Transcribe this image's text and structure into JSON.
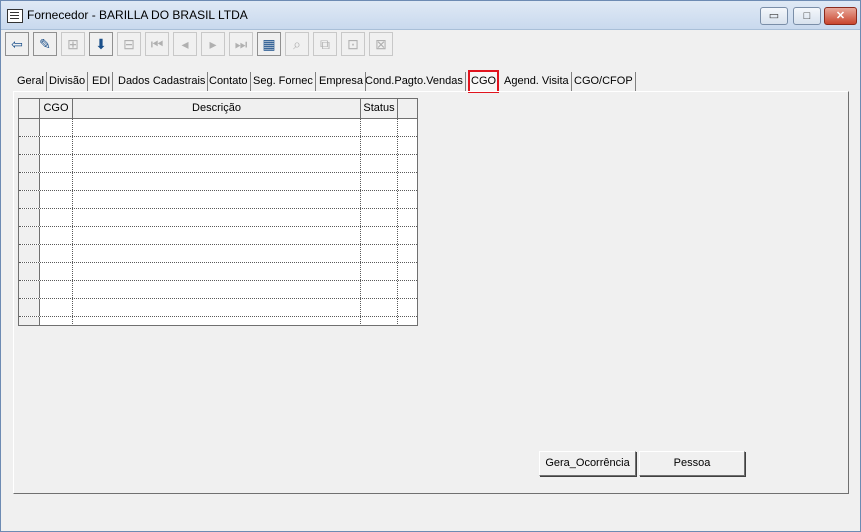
{
  "window": {
    "title": "Fornecedor - BARILLA DO BRASIL LTDA",
    "controls": {
      "minimize": "▭",
      "maximize": "□",
      "close": "✕"
    }
  },
  "toolbar": {
    "buttons": [
      {
        "icon": "exit-door-icon",
        "glyph": "⇦",
        "state": "active"
      },
      {
        "icon": "eraser-icon",
        "glyph": "✎",
        "state": "active"
      },
      {
        "icon": "add-record-icon",
        "glyph": "⊞",
        "state": "disabled"
      },
      {
        "icon": "save-download-icon",
        "glyph": "⬇",
        "state": "active"
      },
      {
        "icon": "remove-record-icon",
        "glyph": "⊟",
        "state": "disabled"
      },
      {
        "icon": "first-record-icon",
        "glyph": "⏮",
        "state": "disabled"
      },
      {
        "icon": "previous-record-icon",
        "glyph": "◂",
        "state": "disabled"
      },
      {
        "icon": "next-record-icon",
        "glyph": "▸",
        "state": "disabled"
      },
      {
        "icon": "last-record-icon",
        "glyph": "⏭",
        "state": "disabled"
      },
      {
        "icon": "report-grid-icon",
        "glyph": "▦",
        "state": "active"
      },
      {
        "icon": "search-icon",
        "glyph": "⌕",
        "state": "disabled"
      },
      {
        "icon": "link-icon",
        "glyph": "⧉",
        "state": "disabled"
      },
      {
        "icon": "edit-record-icon",
        "glyph": "⊡",
        "state": "disabled"
      },
      {
        "icon": "delete-record-icon",
        "glyph": "⊠",
        "state": "disabled"
      }
    ]
  },
  "tabs": [
    {
      "label": "Geral"
    },
    {
      "label": "Divisão"
    },
    {
      "label": "EDI"
    },
    {
      "label": "Dados Cadastrais"
    },
    {
      "label": "Contato"
    },
    {
      "label": "Seg. Fornec"
    },
    {
      "label": "Empresa"
    },
    {
      "label": "Cond.Pagto.Vendas"
    },
    {
      "label": "CGO",
      "selected": true
    },
    {
      "label": "Agend. Visita"
    },
    {
      "label": "CGO/CFOP"
    }
  ],
  "grid": {
    "columns": [
      "CGO",
      "Descrição",
      "Status"
    ],
    "rows": [
      [
        "",
        "",
        ""
      ],
      [
        "",
        "",
        ""
      ],
      [
        "",
        "",
        ""
      ],
      [
        "",
        "",
        ""
      ],
      [
        "",
        "",
        ""
      ],
      [
        "",
        "",
        ""
      ],
      [
        "",
        "",
        ""
      ],
      [
        "",
        "",
        ""
      ],
      [
        "",
        "",
        ""
      ],
      [
        "",
        "",
        ""
      ],
      [
        "",
        "",
        ""
      ],
      [
        "",
        "",
        ""
      ]
    ]
  },
  "buttons": {
    "gera_ocorrencia": "Gera_Ocorrência",
    "pessoa": "Pessoa"
  },
  "colors": {
    "selected_tab_highlight": "#e0141e",
    "close_button": "#c9452e"
  }
}
